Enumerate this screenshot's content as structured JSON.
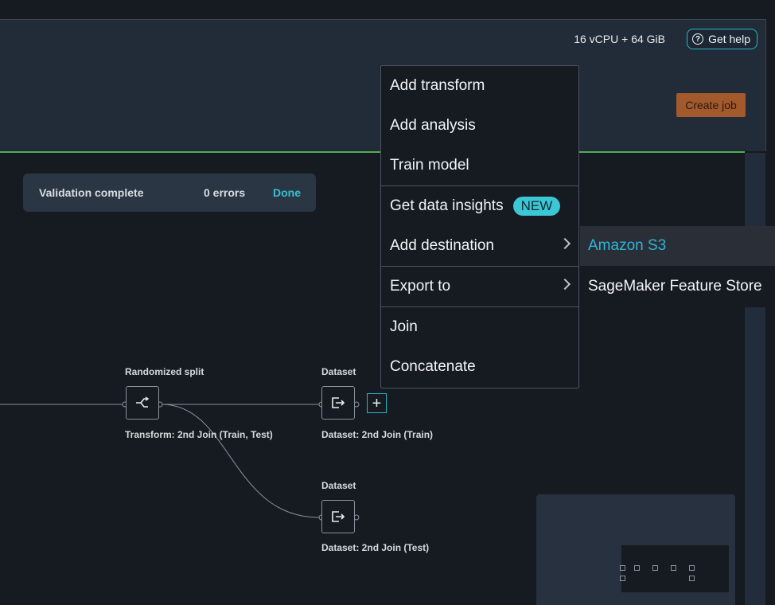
{
  "topbar": {
    "resource_label": "16 vCPU + 64 GiB",
    "help_label": "Get help",
    "help_icon": "question-circle-icon"
  },
  "header": {
    "create_job_label": "Create job"
  },
  "validation": {
    "status": "Validation complete",
    "errors": "0 errors",
    "done_label": "Done"
  },
  "flow": {
    "split_node": {
      "title": "Randomized split",
      "caption": "Transform: 2nd Join (Train, Test)"
    },
    "train_node": {
      "title": "Dataset",
      "caption": "Dataset: 2nd Join (Train)"
    },
    "test_node": {
      "title": "Dataset",
      "caption": "Dataset: 2nd Join (Test)"
    },
    "add_step_label": "+"
  },
  "context_menu": {
    "items": [
      {
        "label": "Add transform"
      },
      {
        "label": "Add analysis"
      },
      {
        "label": "Train model"
      },
      {
        "label": "Get data insights",
        "badge": "NEW"
      },
      {
        "label": "Add destination"
      },
      {
        "label": "Export to"
      },
      {
        "label": "Join"
      },
      {
        "label": "Concatenate"
      }
    ]
  },
  "submenu": {
    "items": [
      {
        "label": "Amazon S3"
      },
      {
        "label": "SageMaker Feature Store"
      }
    ]
  },
  "colors": {
    "accent": "#2bb5c8",
    "create_job": "#a2592c",
    "progress_line": "#4caf50",
    "submenu_active_text": "#2fb4d8"
  }
}
